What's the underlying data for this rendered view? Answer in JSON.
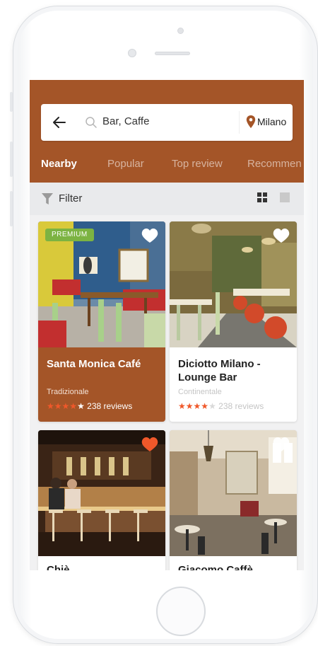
{
  "search": {
    "query": "Bar, Caffe",
    "location": "Milano"
  },
  "tabs": [
    {
      "label": "Nearby",
      "active": true
    },
    {
      "label": "Popular",
      "active": false
    },
    {
      "label": "Top review",
      "active": false
    },
    {
      "label": "Recommen",
      "active": false
    }
  ],
  "filter": {
    "label": "Filter",
    "view_mode": "grid"
  },
  "cards": [
    {
      "name": "Santa Monica Café",
      "category": "Tradizionale",
      "rating": 4,
      "reviews": "238 reviews",
      "badge": "PREMIUM",
      "favorited": false,
      "featured": true
    },
    {
      "name": "Diciotto Milano - Lounge Bar",
      "category": "Continentale",
      "rating": 4,
      "reviews": "238 reviews",
      "badge": "",
      "favorited": false,
      "featured": false
    },
    {
      "name": "Chiè...",
      "category": "",
      "rating": 0,
      "reviews": "",
      "badge": "",
      "favorited": true,
      "featured": false
    },
    {
      "name": "Giacomo Caffè",
      "category": "",
      "rating": 0,
      "reviews": "",
      "badge": "",
      "favorited": false,
      "featured": false
    }
  ],
  "colors": {
    "brand": "#a45528",
    "premium": "#7cb342",
    "star": "#f0582a",
    "heart_active": "#f0582a"
  },
  "icons": [
    "back-arrow-icon",
    "search-icon",
    "location-pin-icon",
    "filter-icon",
    "grid-view-icon",
    "list-view-icon",
    "heart-icon"
  ]
}
